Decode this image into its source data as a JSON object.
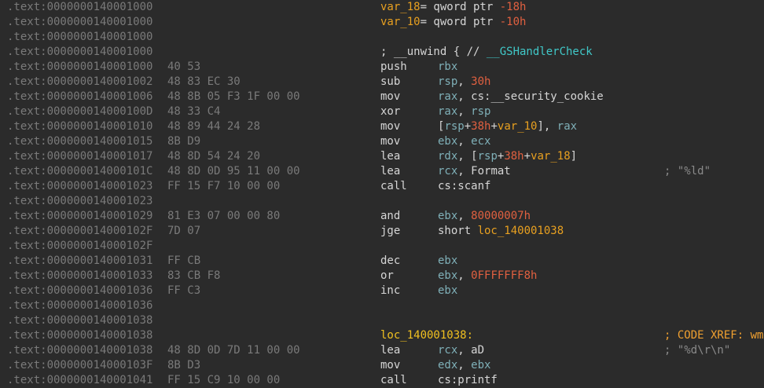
{
  "lines": [
    {
      "addr": ".text:0000000140001000",
      "parts": [
        [
          "sym",
          "var_18"
        ],
        [
          "pl",
          "= qword ptr "
        ],
        [
          "num",
          "-18h"
        ]
      ],
      "part_pos": "mnem"
    },
    {
      "addr": ".text:0000000140001000",
      "parts": [
        [
          "sym",
          "var_10"
        ],
        [
          "pl",
          "= qword ptr "
        ],
        [
          "num",
          "-10h"
        ]
      ],
      "part_pos": "mnem"
    },
    {
      "addr": ".text:0000000140001000"
    },
    {
      "addr": ".text:0000000140001000",
      "parts": [
        [
          "pl",
          "; __unwind { // "
        ],
        [
          "cyan",
          "__GSHandlerCheck"
        ]
      ],
      "part_pos": "mnem"
    },
    {
      "addr": ".text:0000000140001000",
      "bytes": "40 53",
      "mnem": "push",
      "ops": [
        [
          "reg",
          "rbx"
        ]
      ]
    },
    {
      "addr": ".text:0000000140001002",
      "bytes": "48 83 EC 30",
      "mnem": "sub",
      "ops": [
        [
          "reg",
          "rsp"
        ],
        [
          "pl",
          ", "
        ],
        [
          "num",
          "30h"
        ]
      ]
    },
    {
      "addr": ".text:0000000140001006",
      "bytes": "48 8B 05 F3 1F 00 00",
      "mnem": "mov",
      "ops": [
        [
          "reg",
          "rax"
        ],
        [
          "pl",
          ", cs:__security_cookie"
        ]
      ]
    },
    {
      "addr": ".text:000000014000100D",
      "bytes": "48 33 C4",
      "mnem": "xor",
      "ops": [
        [
          "reg",
          "rax"
        ],
        [
          "pl",
          ", "
        ],
        [
          "reg",
          "rsp"
        ]
      ]
    },
    {
      "addr": ".text:0000000140001010",
      "bytes": "48 89 44 24 28",
      "mnem": "mov",
      "ops": [
        [
          "pl",
          "["
        ],
        [
          "reg",
          "rsp"
        ],
        [
          "pl",
          "+"
        ],
        [
          "num",
          "38h"
        ],
        [
          "pl",
          "+"
        ],
        [
          "sym",
          "var_10"
        ],
        [
          "pl",
          "], "
        ],
        [
          "reg",
          "rax"
        ]
      ]
    },
    {
      "addr": ".text:0000000140001015",
      "bytes": "8B D9",
      "mnem": "mov",
      "ops": [
        [
          "reg",
          "ebx"
        ],
        [
          "pl",
          ", "
        ],
        [
          "reg",
          "ecx"
        ]
      ]
    },
    {
      "addr": ".text:0000000140001017",
      "bytes": "48 8D 54 24 20",
      "mnem": "lea",
      "ops": [
        [
          "reg",
          "rdx"
        ],
        [
          "pl",
          ", ["
        ],
        [
          "reg",
          "rsp"
        ],
        [
          "pl",
          "+"
        ],
        [
          "num",
          "38h"
        ],
        [
          "pl",
          "+"
        ],
        [
          "sym",
          "var_18"
        ],
        [
          "pl",
          "]"
        ]
      ]
    },
    {
      "addr": ".text:000000014000101C",
      "bytes": "48 8D 0D 95 11 00 00",
      "mnem": "lea",
      "ops": [
        [
          "reg",
          "rcx"
        ],
        [
          "pl",
          ", Format"
        ]
      ],
      "cmt": "; \"%ld\""
    },
    {
      "addr": ".text:0000000140001023",
      "bytes": "FF 15 F7 10 00 00",
      "mnem": "call",
      "ops": [
        [
          "pl",
          "cs:scanf"
        ]
      ]
    },
    {
      "addr": ".text:0000000140001023"
    },
    {
      "addr": ".text:0000000140001029",
      "bytes": "81 E3 07 00 00 80",
      "mnem": "and",
      "ops": [
        [
          "reg",
          "ebx"
        ],
        [
          "pl",
          ", "
        ],
        [
          "num",
          "80000007h"
        ]
      ]
    },
    {
      "addr": ".text:000000014000102F",
      "bytes": "7D 07",
      "mnem": "jge",
      "ops": [
        [
          "pl",
          "short "
        ],
        [
          "sym",
          "loc_140001038"
        ]
      ]
    },
    {
      "addr": ".text:000000014000102F"
    },
    {
      "addr": ".text:0000000140001031",
      "bytes": "FF CB",
      "mnem": "dec",
      "ops": [
        [
          "reg",
          "ebx"
        ]
      ]
    },
    {
      "addr": ".text:0000000140001033",
      "bytes": "83 CB F8",
      "mnem": "or",
      "ops": [
        [
          "reg",
          "ebx"
        ],
        [
          "pl",
          ", "
        ],
        [
          "num",
          "0FFFFFFF8h"
        ]
      ]
    },
    {
      "addr": ".text:0000000140001036",
      "bytes": "FF C3",
      "mnem": "inc",
      "ops": [
        [
          "reg",
          "ebx"
        ]
      ]
    },
    {
      "addr": ".text:0000000140001036"
    },
    {
      "addr": ".text:0000000140001038"
    },
    {
      "addr": ".text:0000000140001038",
      "label": "loc_140001038:",
      "cmt": "; CODE XREF: wm",
      "cmt_orange": true
    },
    {
      "addr": ".text:0000000140001038",
      "bytes": "48 8D 0D 7D 11 00 00",
      "mnem": "lea",
      "ops": [
        [
          "reg",
          "rcx"
        ],
        [
          "pl",
          ", aD"
        ]
      ],
      "cmt": "; \"%d\\r\\n\""
    },
    {
      "addr": ".text:000000014000103F",
      "bytes": "8B D3",
      "mnem": "mov",
      "ops": [
        [
          "reg",
          "edx"
        ],
        [
          "pl",
          ", "
        ],
        [
          "reg",
          "ebx"
        ]
      ]
    },
    {
      "addr": ".text:0000000140001041",
      "bytes": "FF 15 C9 10 00 00",
      "mnem": "call",
      "ops": [
        [
          "pl",
          "cs:printf"
        ]
      ]
    }
  ]
}
